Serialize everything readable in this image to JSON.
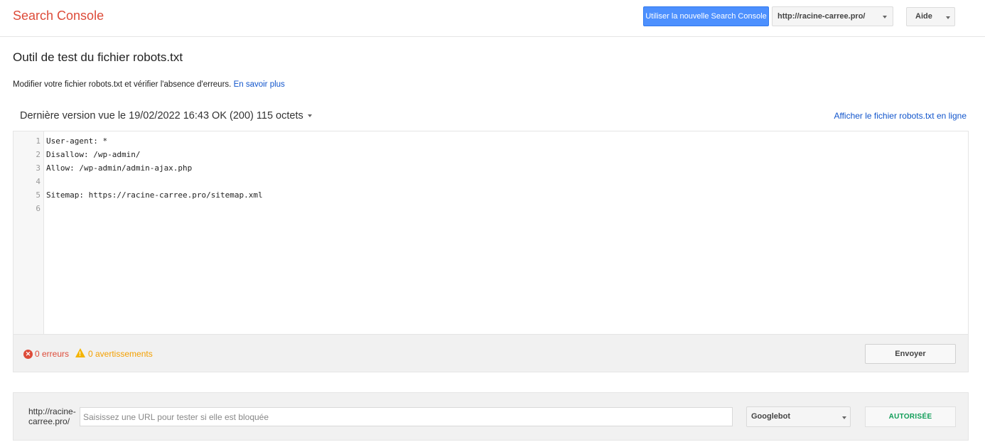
{
  "header": {
    "brand": "Search Console",
    "new_console_button": "Utiliser la nouvelle Search Console",
    "site_selector": "http://racine-carree.pro/",
    "help_menu": "Aide"
  },
  "page": {
    "title": "Outil de test du fichier robots.txt",
    "intro_text": "Modifier votre fichier robots.txt et vérifier l'absence d'erreurs.",
    "learn_more_link": "En savoir plus",
    "version_label": "Dernière version vue le 19/02/2022 16:43 OK (200) 115 octets",
    "view_live_link": "Afficher le fichier robots.txt en ligne"
  },
  "editor": {
    "lines": [
      {
        "num": "1",
        "text": "User-agent: *"
      },
      {
        "num": "2",
        "text": "Disallow: /wp-admin/"
      },
      {
        "num": "3",
        "text": "Allow: /wp-admin/admin-ajax.php"
      },
      {
        "num": "4",
        "text": ""
      },
      {
        "num": "5",
        "text": "Sitemap: https://racine-carree.pro/sitemap.xml"
      },
      {
        "num": "6",
        "text": ""
      }
    ]
  },
  "status": {
    "errors": "0 erreurs",
    "warnings": "0 avertissements",
    "submit_button": "Envoyer"
  },
  "url_test": {
    "prefix": "http://racine-carree.pro/",
    "placeholder": "Saisissez une URL pour tester si elle est bloquée",
    "value": "",
    "user_agent": "Googlebot",
    "result": "AUTORISÉE"
  },
  "colors": {
    "brand": "#dd4b39",
    "primary_button": "#4d90fe",
    "link": "#1155cc",
    "error": "#dd4b39",
    "warning": "#f4b400",
    "allowed": "#0f9d58"
  }
}
